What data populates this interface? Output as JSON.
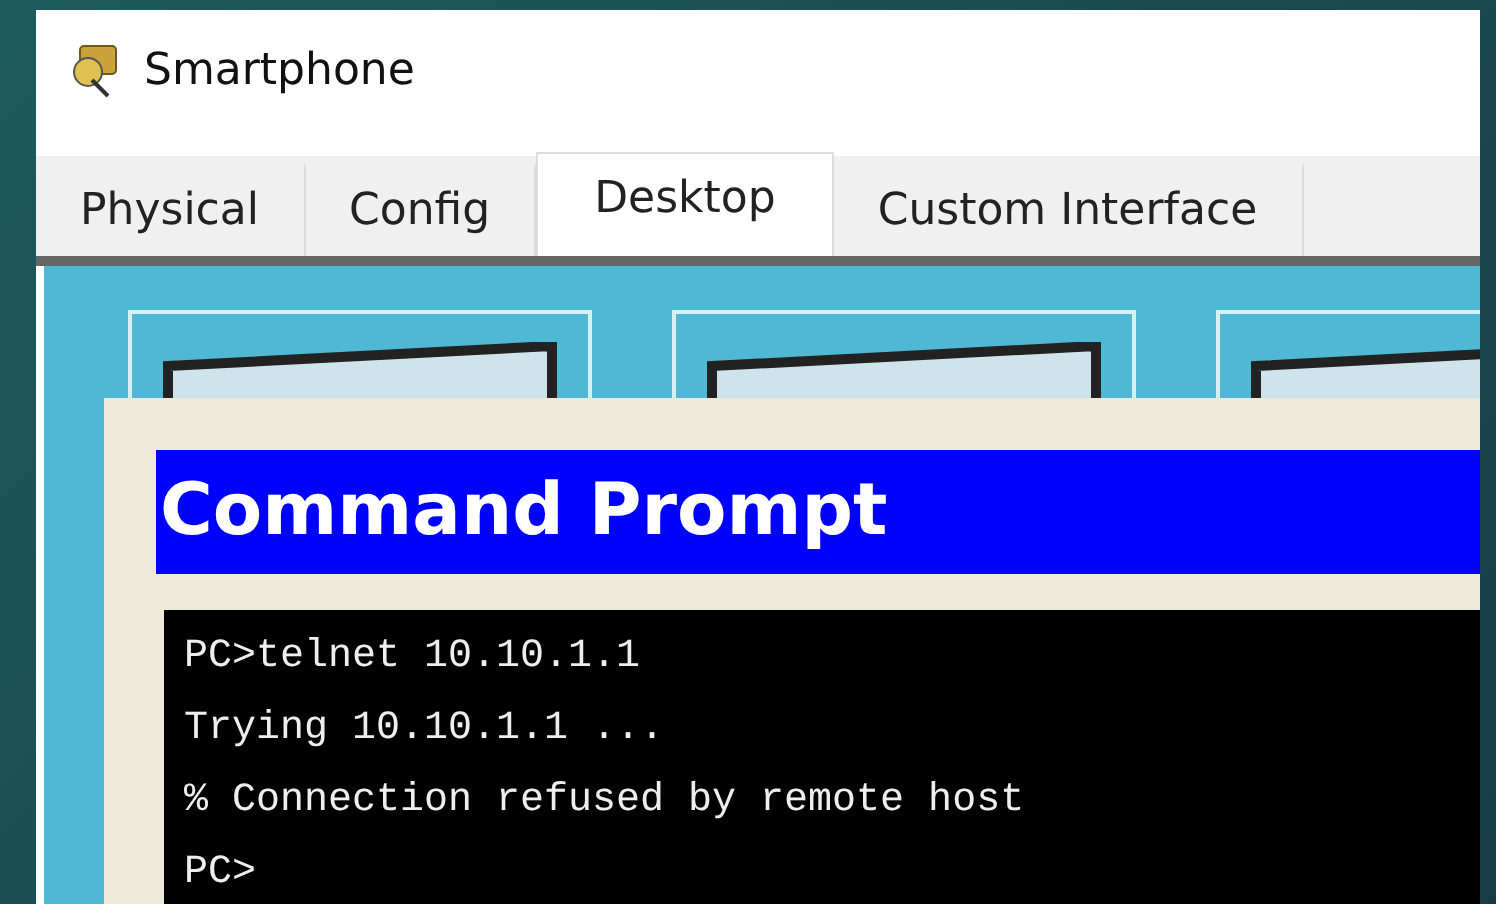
{
  "window": {
    "title": "Smartphone"
  },
  "tabs": [
    {
      "label": "Physical",
      "selected": false
    },
    {
      "label": "Config",
      "selected": false
    },
    {
      "label": "Desktop",
      "selected": true
    },
    {
      "label": "Custom Interface",
      "selected": false
    }
  ],
  "command_prompt": {
    "title": "Command Prompt",
    "lines": [
      "PC>telnet 10.10.1.1",
      "Trying 10.10.1.1 ...",
      "% Connection refused by remote host",
      "PC>"
    ]
  }
}
